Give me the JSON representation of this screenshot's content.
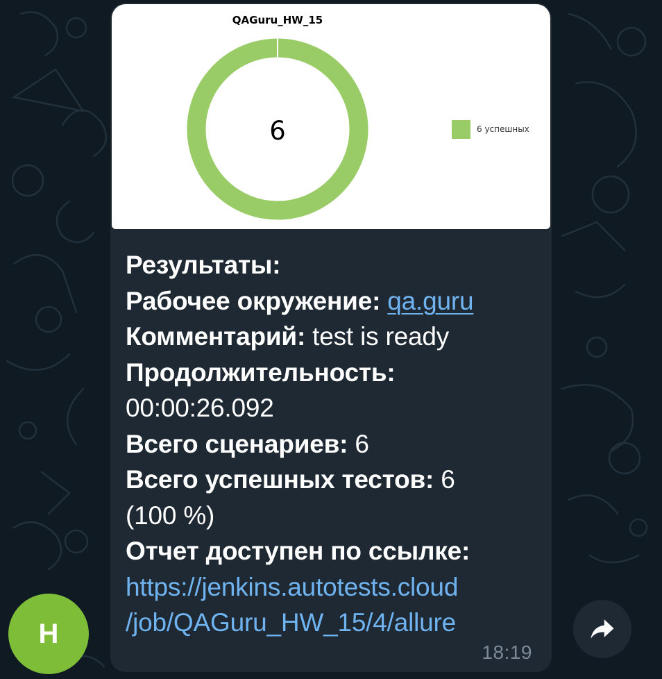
{
  "chart": {
    "title": "QAGuru_HW_15",
    "center_label": "6",
    "legend_label": "6 успешных",
    "color": "#99cc66"
  },
  "chart_data": {
    "type": "pie",
    "title": "QAGuru_HW_15",
    "categories": [
      "6 успешных"
    ],
    "values": [
      6
    ],
    "center_label": "6",
    "legend": "right",
    "colors": [
      "#99cc66"
    ]
  },
  "message": {
    "results_label": "Результаты:",
    "environment_label": "Рабочее окружение: ",
    "environment_link": "qa.guru",
    "comment_label": "Комментарий: ",
    "comment_value": "test is ready",
    "duration_label": "Продолжительность:",
    "duration_value": "00:00:26.092",
    "scenarios_label": "Всего сценариев: ",
    "scenarios_value": "6",
    "passed_label": "Всего успешных тестов: ",
    "passed_value": "6",
    "passed_percent": "(100 %)",
    "report_label": "Отчет доступен по ссылке:",
    "report_link_line1": "https://jenkins.autotests.cloud",
    "report_link_line2": "/job/QAGuru_HW_15/4/allure",
    "time": "18:19"
  },
  "sender": {
    "avatar_letter": "H",
    "avatar_color": "#7dbd37"
  },
  "icons": {
    "share": "share-arrow-icon"
  }
}
